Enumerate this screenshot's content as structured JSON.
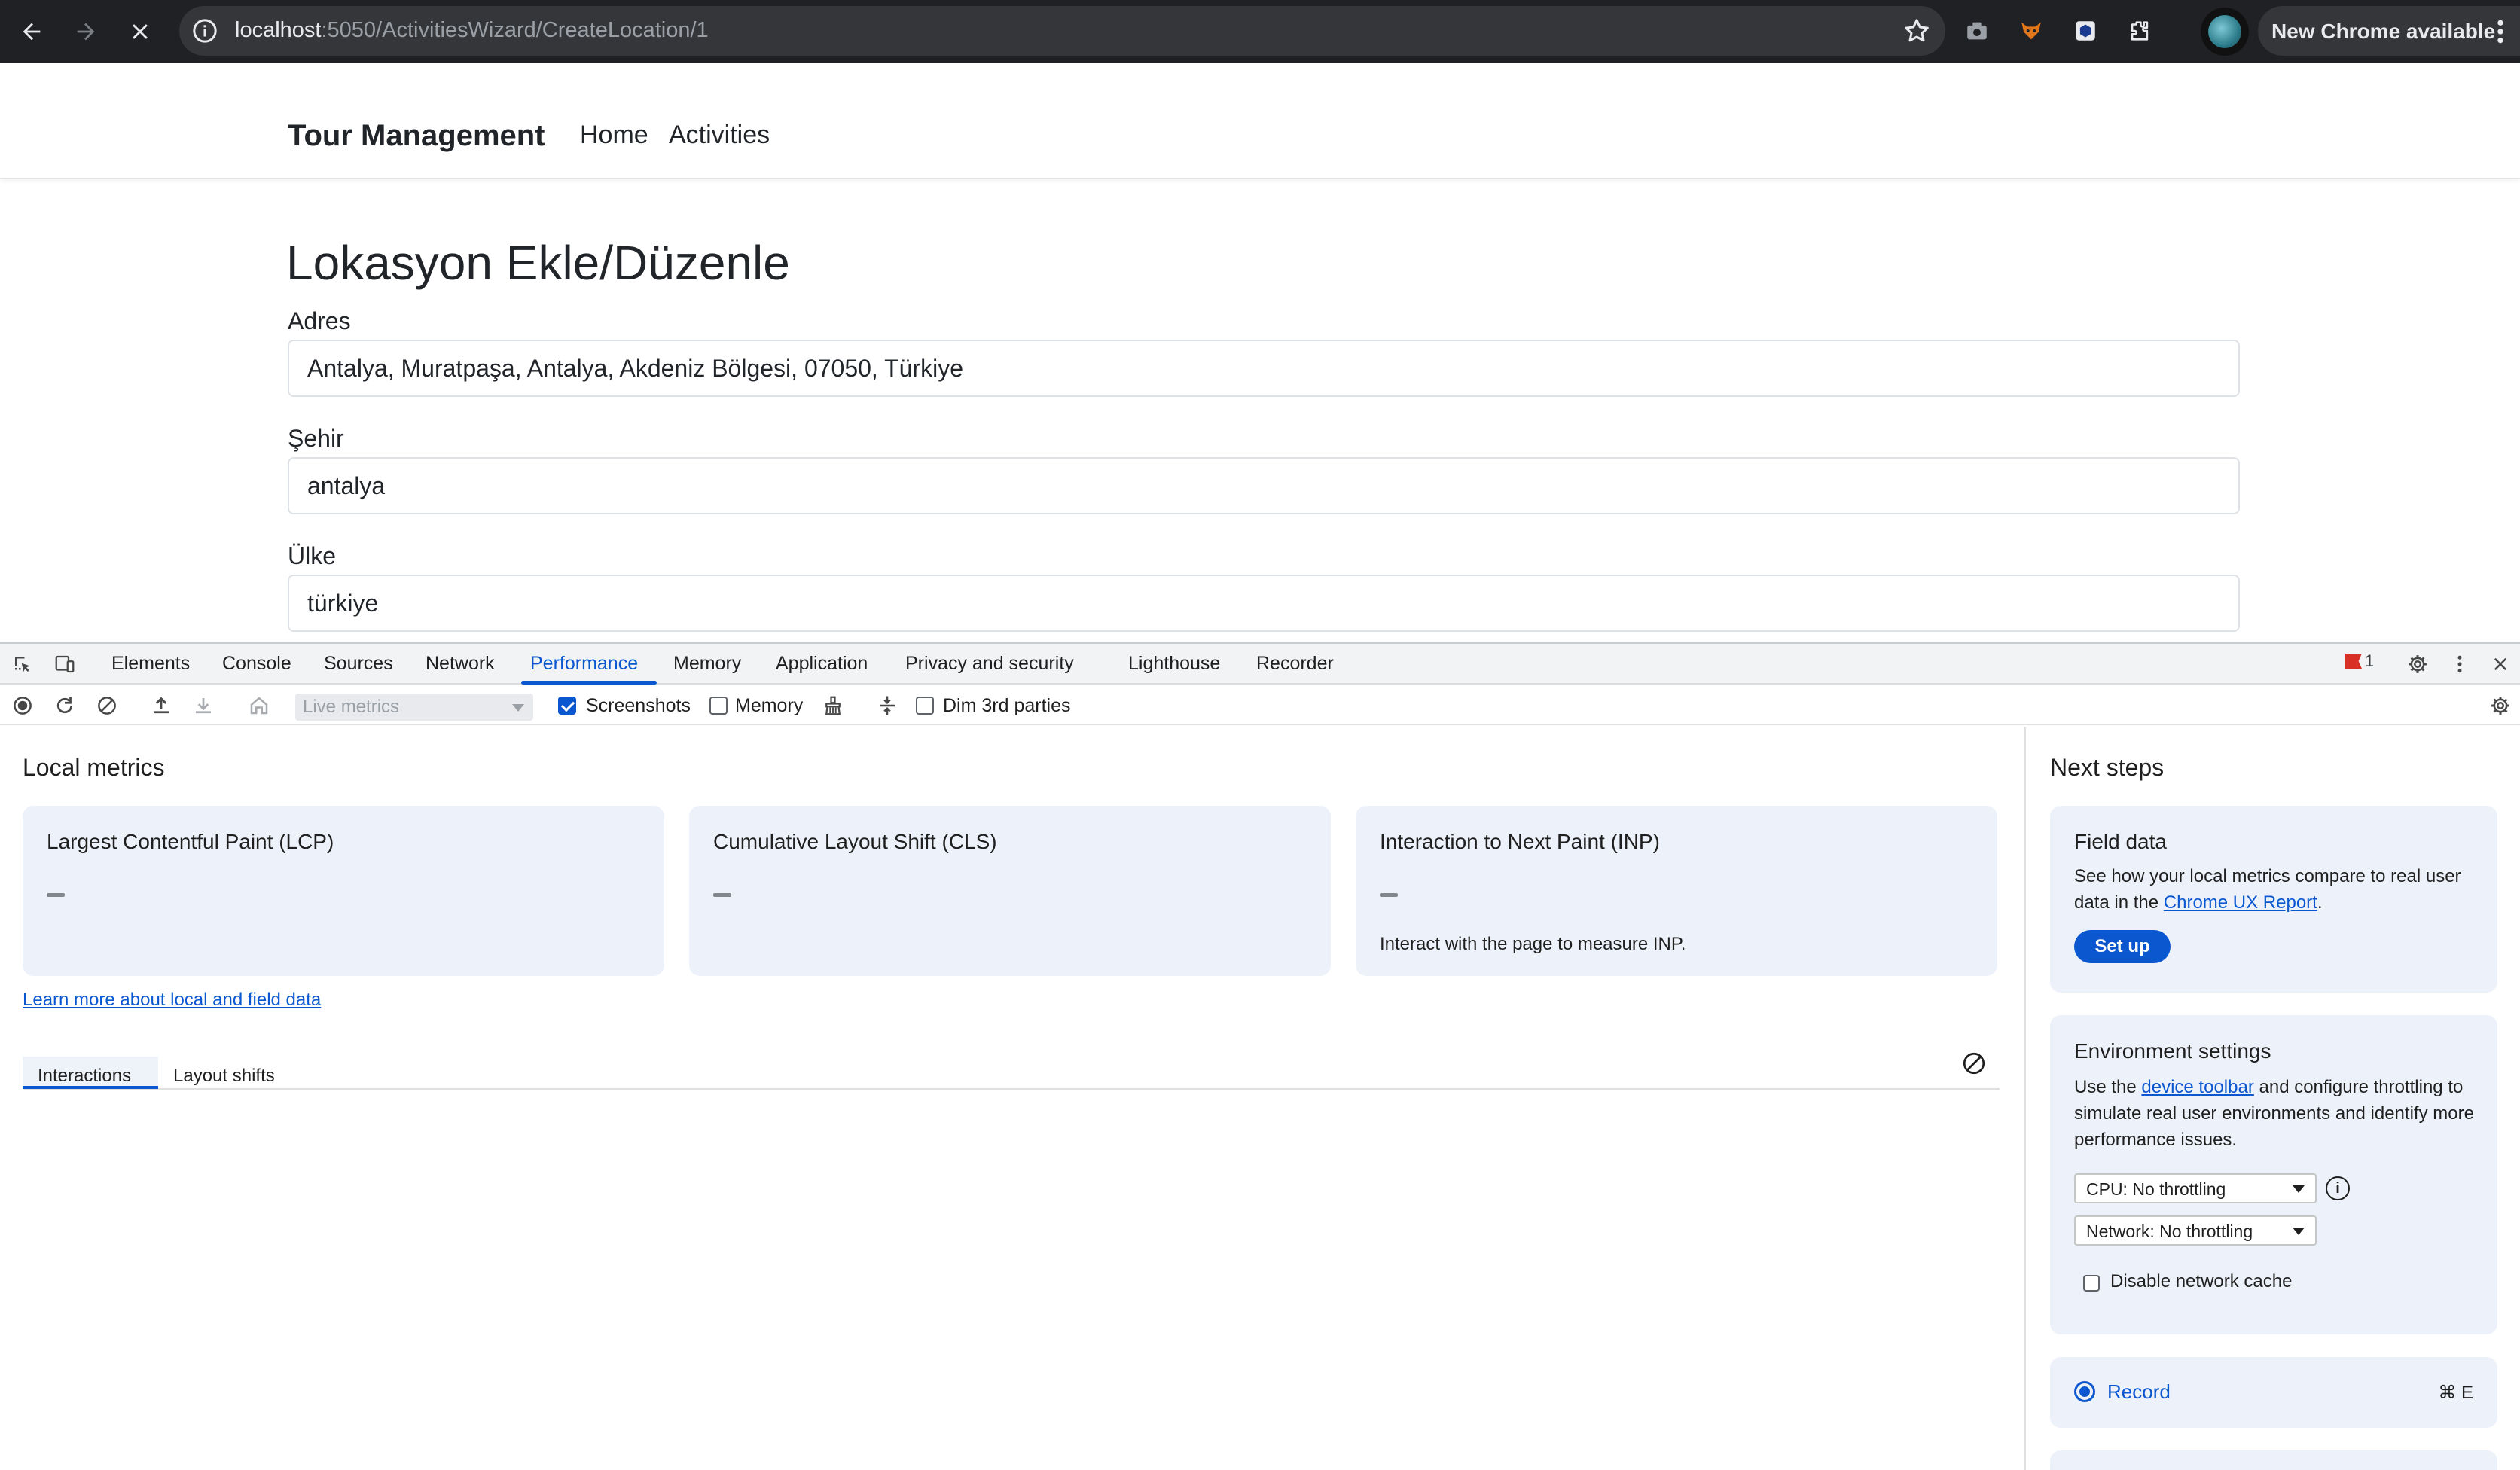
{
  "browser": {
    "url_host": "localhost",
    "url_path": ":5050/ActivitiesWizard/CreateLocation/1",
    "update_label": "New Chrome available"
  },
  "navbar": {
    "brand": "Tour Management",
    "links": [
      "Home",
      "Activities"
    ]
  },
  "form": {
    "title": "Lokasyon Ekle/Düzenle",
    "fields": [
      {
        "label": "Adres",
        "value": "Antalya, Muratpaşa, Antalya, Akdeniz Bölgesi, 07050, Türkiye"
      },
      {
        "label": "Şehir",
        "value": "antalya"
      },
      {
        "label": "Ülke",
        "value": "türkiye"
      }
    ]
  },
  "devtools": {
    "tabs": [
      "Elements",
      "Console",
      "Sources",
      "Network",
      "Performance",
      "Memory",
      "Application",
      "Privacy and security",
      "Lighthouse",
      "Recorder"
    ],
    "active_tab": "Performance",
    "issues_count": "1",
    "toolbar": {
      "live_metrics": "Live metrics",
      "screenshots_label": "Screenshots",
      "screenshots_checked": true,
      "memory_label": "Memory",
      "memory_checked": false,
      "dim_label": "Dim 3rd parties",
      "dim_checked": false
    },
    "local_metrics": {
      "title": "Local metrics",
      "cards": [
        {
          "name": "Largest Contentful Paint (LCP)",
          "value": "–",
          "note": ""
        },
        {
          "name": "Cumulative Layout Shift (CLS)",
          "value": "–",
          "note": ""
        },
        {
          "name": "Interaction to Next Paint (INP)",
          "value": "–",
          "note": "Interact with the page to measure INP."
        }
      ],
      "learn_more": "Learn more about local and field data",
      "sub_tabs": [
        "Interactions",
        "Layout shifts"
      ]
    },
    "next_steps": {
      "title": "Next steps",
      "field_data": {
        "title": "Field data",
        "text_before": "See how your local metrics compare to real user data in the ",
        "link": "Chrome UX Report",
        "text_after": ".",
        "button": "Set up"
      },
      "environment": {
        "title": "Environment settings",
        "text_before": "Use the ",
        "link": "device toolbar",
        "text_after": " and configure throttling to simulate real user environments and identify more performance issues.",
        "cpu": "CPU: No throttling",
        "network": "Network: No throttling",
        "disable_cache": "Disable network cache"
      },
      "record": {
        "label": "Record",
        "shortcut": "⌘ E"
      }
    }
  },
  "colors": {
    "accent": "#0b57d0",
    "chrome_dark": "#202124",
    "card_bg": "#edf2fa"
  }
}
